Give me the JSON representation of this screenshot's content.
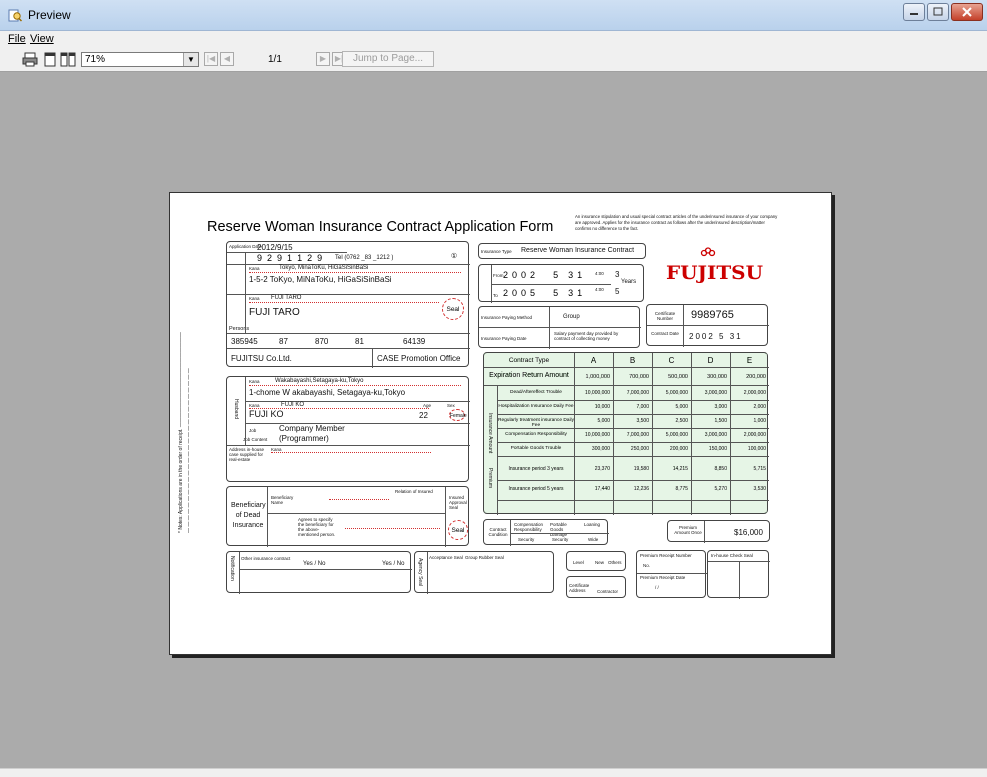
{
  "window": {
    "title": "Preview"
  },
  "menu": {
    "file": "File",
    "view": "View"
  },
  "toolbar": {
    "zoom_value": "71%",
    "page_count": "1/1",
    "jump_label": "Jump to Page..."
  },
  "colors": {
    "titlebar": "#c5d9f1",
    "workspace": "#ababab",
    "accent_red": "#cc0000",
    "dot_green": "#9bd79b"
  },
  "form": {
    "title": "Reserve Woman Insurance Contract Application Form",
    "notice": "An insurance stipulation and usual special contract articles of the underinsured insurance of your company are approved. Applies for the insurance contract as follows after the underinsured description/matter confirms no difference to the fact.",
    "logo_text": "FUJITSU",
    "application_date_label": "Application Date",
    "application_date": "2012/9/15",
    "dob": [
      "9",
      "2",
      "9",
      "1",
      "1",
      "2",
      "9"
    ],
    "tel": "Tel (0762 _83 _1212 )",
    "kana_address": "Tokyo, MinaToKu, HiGaSiSinBaSi",
    "address": "1-5-2 ToKyo, MiNaToKu, HiGaSiSinBaSi",
    "address_label": "Address",
    "name_kana": "FUJI TARO",
    "name": "FUJI TARO",
    "seal": "Seal",
    "person_label": "Persons",
    "zip": "385945",
    "office_values": [
      "87",
      "870",
      "81",
      "64139"
    ],
    "company": "FUJITSU Co.Ltd.",
    "dept": "CASE Promotion Office",
    "kana_label": "Kana",
    "spouse_address_kana": "Wakabayashi,Setagaya-ku,Tokyo",
    "spouse_address": "1-chome W akabayashi, Setagaya-ku,Tokyo",
    "spouse_name_kana": "FUJI KO",
    "spouse_name": "FUJI KO",
    "age_label": "Age",
    "age": "22",
    "sex_label": "Sex",
    "sex": "Female",
    "job_label": "Job",
    "job": "Company Member",
    "job_content_label": "Job Content",
    "job_content": "(Programmer)",
    "spouse_label": "Husband",
    "address_in_house_label": "Address in-house case supplied for real-estate",
    "beneficiary_label": "Beneficiary of Dead Insurance",
    "beneficiary_name_label": "Beneficiary Name",
    "agree_label": "Agrees to specify the beneficiary for the above-mentioned person.",
    "relation_label": "Relation of Insured",
    "insured_approval": "Insured Approval Seal",
    "insurance_type_label": "Insurance Type",
    "insurance_type": "Reserve Woman Insurance Contract",
    "from_label": "From",
    "to_label": "To",
    "from_date": [
      "2",
      "0",
      "0",
      "2",
      "5",
      "3",
      "1"
    ],
    "to_date": [
      "2",
      "0",
      "0",
      "5",
      "5",
      "3",
      "1"
    ],
    "time_value": "4:00",
    "period_mark_a": "3",
    "period_mark_b": "5",
    "years": "Years",
    "paying_method_label": "Insurance Paying Method",
    "paying_method": "Group",
    "paying_date_label": "Insurance Paying Date",
    "paying_date": "Salary payment day provided by contract of collecting money",
    "certificate_label": "Certificate Number",
    "certificate_number": "9989765",
    "contract_date_label": "Contract Date",
    "contract_date": "2002 5 31",
    "contract_type_label": "Contract Type",
    "types": [
      "A",
      "B",
      "C",
      "D",
      "E"
    ],
    "return_label": "Expiration Return Amount",
    "return_values": [
      "1,000,000",
      "700,000",
      "500,000",
      "300,000",
      "200,000"
    ],
    "section_label": "Insurance Amount",
    "rows": [
      {
        "label": "Dead/Aftereffect Trouble",
        "values": [
          "10,000,000",
          "7,000,000",
          "5,000,000",
          "3,000,000",
          "2,000,000"
        ]
      },
      {
        "label": "Hospitalization Insurance Daily Fee",
        "values": [
          "10,000",
          "7,000",
          "5,000",
          "3,000",
          "2,000"
        ]
      },
      {
        "label": "Regularly treatment insurance Daily Fee",
        "values": [
          "5,000",
          "3,500",
          "2,500",
          "1,500",
          "1,000"
        ]
      },
      {
        "label": "Compensation Responsibility",
        "values": [
          "10,000,000",
          "7,000,000",
          "5,000,000",
          "3,000,000",
          "2,000,000"
        ]
      },
      {
        "label": "Portable Goods Trouble",
        "values": [
          "300,000",
          "250,000",
          "200,000",
          "150,000",
          "100,000"
        ]
      }
    ],
    "premium_label": "Premium",
    "premium_rows": [
      {
        "label": "Insurance period 3 years",
        "values": [
          "23,370",
          "19,580",
          "14,215",
          "8,850",
          "5,715"
        ]
      },
      {
        "label": "Insurance period 5 years",
        "values": [
          "17,440",
          "12,236",
          "8,775",
          "5,270",
          "3,530"
        ]
      }
    ],
    "contract_condition_label": "Contract Condition",
    "condition_cols": [
      "Compensation Responsibility",
      "Portable Goods Damage",
      "Loaning"
    ],
    "condition_vals": [
      "Security",
      "Security",
      "Wide"
    ],
    "premium_amount_label": "Premium Amount Once",
    "premium_amount": "$16,000",
    "notification_label": "Notification",
    "other_contract_label": "Other insurance contract",
    "yes_no": "Yes / No",
    "acceptance_label": "Acceptance Seal",
    "group_rubber_label": "Group Rubber Seal",
    "agency_label": "Agency Seal",
    "level_label": "Level",
    "new_label": "New",
    "others_label": "Others",
    "cert_address_label": "Certificate Address",
    "contractor_label": "Contractor",
    "receipt_number_label": "Premium Receipt Number",
    "receipt_no": "No.",
    "receipt_date_label": "Premium Receipt Date",
    "receipt_date": "/ /",
    "inhouse_check": "In-house Check Seal"
  }
}
